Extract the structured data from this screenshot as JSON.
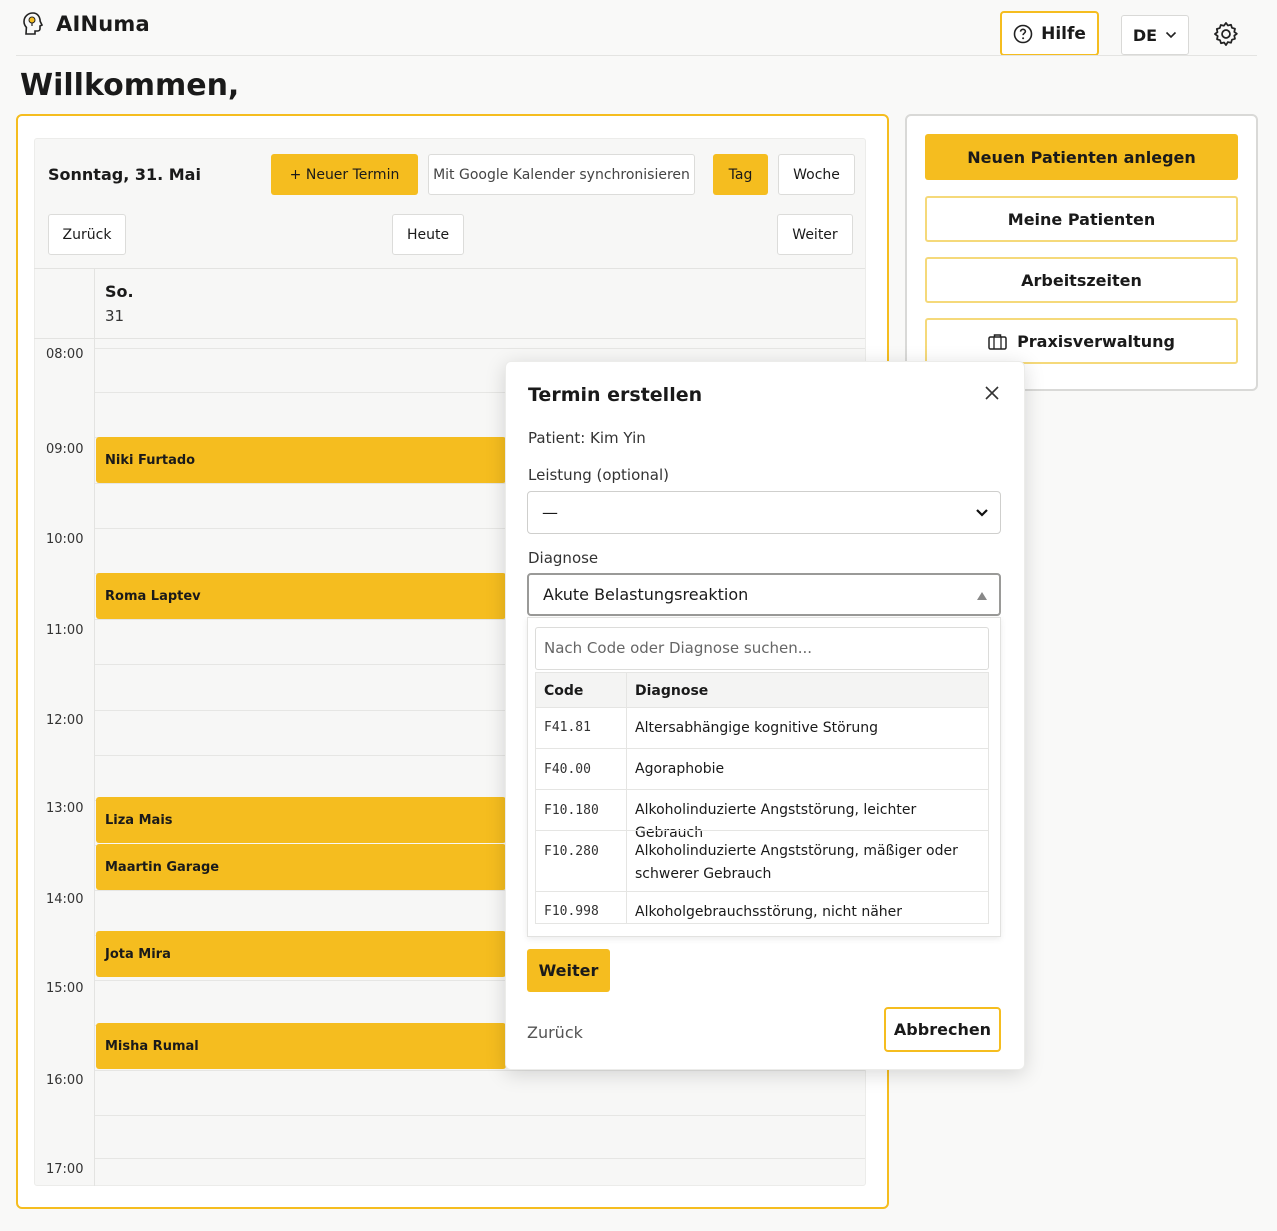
{
  "header": {
    "app_name": "AINuma",
    "help_label": "Hilfe",
    "language": "DE"
  },
  "welcome": "Willkommen,",
  "calendar": {
    "date_title": "Sonntag, 31. Mai",
    "new_appointment": "+ Neuer Termin",
    "google_sync": "Mit Google Kalender synchronisieren",
    "view_day": "Tag",
    "view_week": "Woche",
    "back": "Zurück",
    "today": "Heute",
    "next": "Weiter",
    "day_name": "So.",
    "day_number": "31",
    "times": [
      "08:00",
      "09:00",
      "10:00",
      "11:00",
      "12:00",
      "13:00",
      "14:00",
      "15:00",
      "16:00",
      "17:00"
    ],
    "events": [
      "Niki Furtado",
      "Roma Laptev",
      "Liza Mais",
      "Maartin Garage",
      "Jota Mira",
      "Misha Rumal"
    ]
  },
  "sidebar": {
    "new_patient": "Neuen Patienten anlegen",
    "my_patients": "Meine Patienten",
    "work_hours": "Arbeitszeiten",
    "practice_management": "Praxisverwaltung"
  },
  "modal": {
    "title": "Termin erstellen",
    "patient": "Patient: Kim Yin",
    "service_label": "Leistung (optional)",
    "service_value": "—",
    "diagnosis_label": "Diagnose",
    "diagnosis_value": "Akute Belastungsreaktion",
    "search_placeholder": "Nach Code oder Diagnose suchen...",
    "col_code": "Code",
    "col_diagnosis": "Diagnose",
    "rows": [
      {
        "code": "F41.81",
        "diagnosis": "Altersabhängige kognitive Störung"
      },
      {
        "code": "F40.00",
        "diagnosis": "Agoraphobie"
      },
      {
        "code": "F10.180",
        "diagnosis": "Alkoholinduzierte Angststörung, leichter Gebrauch"
      },
      {
        "code": "F10.280",
        "diagnosis": "Alkoholinduzierte Angststörung, mäßiger oder schwerer Gebrauch"
      },
      {
        "code": "F10.998",
        "diagnosis": "Alkoholgebrauchsstörung, nicht näher bezeichnet"
      }
    ],
    "next": "Weiter",
    "back": "Zurück",
    "cancel": "Abbrechen"
  },
  "colors": {
    "accent": "#f5bd1f",
    "background": "#f9f9f8"
  }
}
